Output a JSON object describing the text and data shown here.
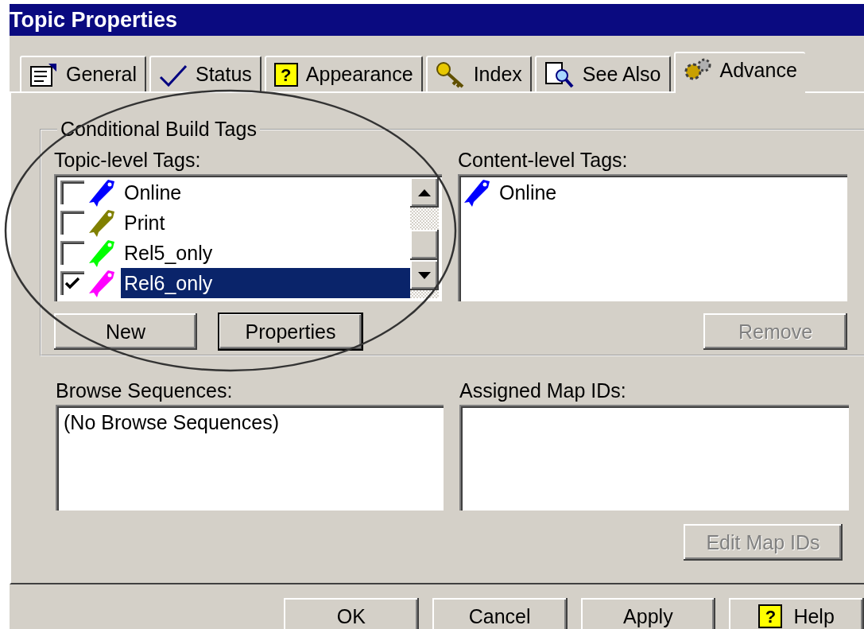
{
  "window": {
    "title": "Topic Properties"
  },
  "tabs": [
    {
      "label": "General",
      "kind": "properties",
      "selected": false
    },
    {
      "label": "Status",
      "kind": "check",
      "selected": false
    },
    {
      "label": "Appearance",
      "kind": "help",
      "glyph": "?",
      "selected": false
    },
    {
      "label": "Index",
      "kind": "key",
      "selected": false
    },
    {
      "label": "See Also",
      "kind": "search",
      "selected": false
    },
    {
      "label": "Advance",
      "kind": "gears",
      "selected": true
    }
  ],
  "group": {
    "title": "Conditional Build Tags",
    "topic_tags": {
      "label": "Topic-level Tags:",
      "items": [
        {
          "name": "Online",
          "color": "#0000ff",
          "checked": false,
          "selected": false
        },
        {
          "name": "Print",
          "color": "#808000",
          "checked": false,
          "selected": false
        },
        {
          "name": "Rel5_only",
          "color": "#00ff00",
          "checked": false,
          "selected": false
        },
        {
          "name": "Rel6_only",
          "color": "#ff00ff",
          "checked": true,
          "selected": true
        }
      ]
    },
    "content_tags": {
      "label": "Content-level Tags:",
      "items": [
        {
          "name": "Online",
          "color": "#0000ff"
        }
      ]
    },
    "buttons": [
      {
        "label": "New",
        "default": false,
        "disabled": false
      },
      {
        "label": "Properties",
        "default": true,
        "disabled": false
      }
    ],
    "remove_button": {
      "label": "Remove",
      "disabled": true
    }
  },
  "browse_sequences": {
    "label": "Browse Sequences:",
    "items": [
      "(No Browse Sequences)"
    ]
  },
  "map_ids": {
    "label": "Assigned Map IDs:",
    "button": {
      "label": "Edit Map IDs",
      "disabled": true
    }
  },
  "footer_buttons": [
    {
      "label": "OK"
    },
    {
      "label": "Cancel"
    },
    {
      "label": "Apply"
    },
    {
      "label": "Help",
      "glyph": "?"
    }
  ]
}
